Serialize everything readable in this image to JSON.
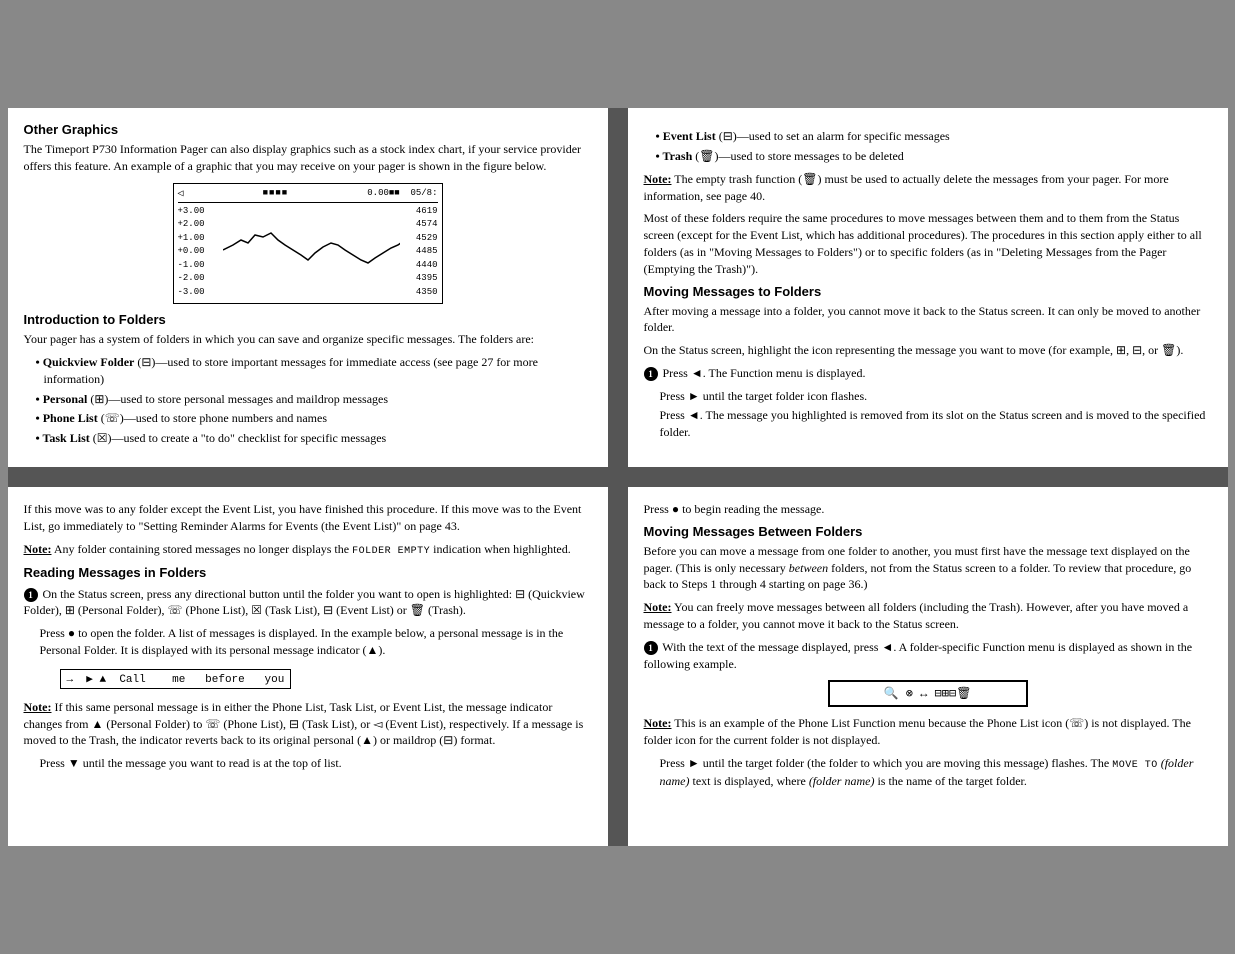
{
  "panel_tl": {
    "title": "Other Graphics",
    "intro": "The Timeport P730 Information Pager can also display graphics such as a stock index chart, if your service provider offers this feature. An example of a graphic that you may receive on your pager is shown in the figure below.",
    "chart": {
      "header_left": "◁",
      "header_center": "■■■■",
      "header_right": "0.00⬛⬛   05/8:",
      "left_labels": [
        "+3.00",
        "+2.00",
        "+1.00",
        "+0.00",
        "-1.00",
        "-2.00",
        "-3.00"
      ],
      "right_labels": [
        "4619",
        "4574",
        "4529",
        "4485",
        "4440",
        "4395",
        "4350"
      ]
    },
    "section2_title": "Introduction to Folders",
    "section2_intro": "Your pager has a system of folders in which you can save and organize specific messages. The folders are:",
    "bullets": [
      "Quickview Folder (⊡)—used to store important messages for immediate access (see page 27 for more information)",
      "Personal (⊞)—used to store personal messages and maildrop messages",
      "Phone List (☏)—used to store phone numbers and names",
      "Task List (☑)—used to create a \"to do\" checklist for specific messages"
    ]
  },
  "panel_tr": {
    "bullets": [
      "Event List (⊟)—used to set an alarm for specific messages",
      "Trash (🗑)—used to store messages to be deleted"
    ],
    "note": "The empty trash function (🗑) must be used to actually delete the messages from your pager. For more information, see page 40.",
    "para1": "Most of these folders require the same procedures to move messages between them and to them from the Status screen (except for the Event List, which has additional procedures). The procedures in this section apply either to all folders (as in \"Moving Messages to Folders\") or to specific folders (as in \"Deleting Messages from the Pager (Emptying the Trash)\").",
    "section_title": "Moving Messages to Folders",
    "para2": "After moving a message into a folder, you cannot move it back to the Status screen. It can only be moved to another folder.",
    "para3": "On the Status screen, highlight the icon representing the message you want to move (for example, ⊞, ⊡, or 🗑).",
    "step1": "Press ◀. The Function menu is displayed.",
    "substep1": "Press ▶ until the target folder icon flashes.",
    "substep2": "Press ◀. The message you highlighted is removed from its slot on the Status screen and is moved to the specified folder."
  },
  "panel_bl": {
    "para1": "If this move was to any folder except the Event List, you have finished this procedure. If this move was to the Event List, go immediately to \"Setting Reminder Alarms for Events (the Event List)\" on page 43.",
    "note": "Any folder containing stored messages no longer displays the FOLDER EMPTY indication when highlighted.",
    "section_title": "Reading Messages in Folders",
    "step1": "On the Status screen, press any directional button until the folder you want to open is highlighted: ⊡ (Quickview Folder), ⊞ (Personal Folder), ☏ (Phone List), ☑ (Task List), ⊟ (Event List) or 🗑 (Trash).",
    "substep1_a": "Press ● to open the folder. A list of messages is displayed. In the example below, a personal message is in the Personal Folder. It is displayed with its personal message indicator (▲).",
    "call_display": "→  ▶ ▲  Call    me    before    you",
    "note2": "If this same personal message is in either the Phone List, Task List, or Event List, the message indicator changes from ▲ (Personal Folder) to ☏ (Phone List), ⊟ (Task List), or ⊟ (Event List), respectively. If a message is moved to the Trash, the indicator reverts back to its original personal (▲) or maildrop (⊡) format.",
    "substep2": "Press ▼ until the message you want to read is at the top of list."
  },
  "panel_br": {
    "para1": "Press ● to begin reading the message.",
    "section_title": "Moving Messages Between Folders",
    "para2": "Before you can move a message from one folder to another, you must first have the message text displayed on the pager. (This is only necessary between folders, not from the Status screen to a folder. To review that procedure, go back to Steps 1 through 4 starting on page 36.)",
    "note1": "You can freely move messages between all folders (including the Trash). However, after you have moved a message to a folder, you cannot move it back to the Status screen.",
    "step1": "With the text of the message displayed, press ◀. A folder-specific Function menu is displayed as shown in the following example.",
    "function_menu": "🔍 ⊗ ↔ ⊡⊞⊟🗑",
    "note2": "This is an example of the Phone List Function menu because the Phone List icon (☏) is not displayed. The folder icon for the current folder is not displayed.",
    "substep1": "Press ▶ until the target folder (the folder to which you are moving this message) flashes. The MOVE TO (folder name) text is displayed, where (folder name) is the name of the target folder."
  }
}
